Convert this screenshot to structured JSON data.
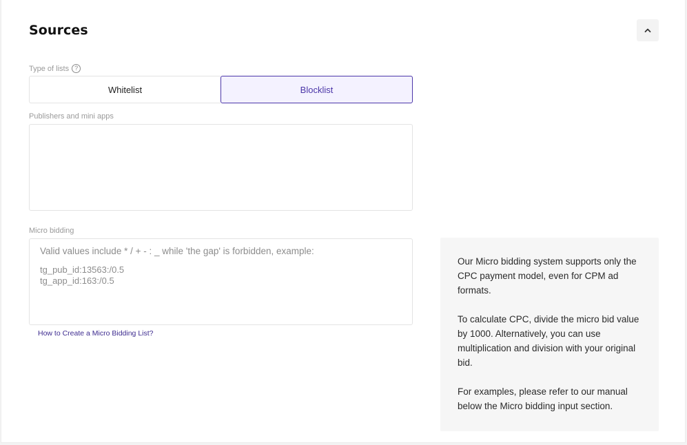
{
  "section": {
    "title": "Sources",
    "collapse_icon": "chevron-up-icon"
  },
  "type_of_lists": {
    "label": "Type of lists",
    "help_icon": "question-circle-icon",
    "options": [
      {
        "label": "Whitelist",
        "selected": false
      },
      {
        "label": "Blocklist",
        "selected": true
      }
    ]
  },
  "publishers": {
    "label": "Publishers and mini apps",
    "value": ""
  },
  "micro_bidding": {
    "label": "Micro bidding",
    "placeholder_lines": [
      "Valid values include * / + - : _ while 'the gap' is forbidden, example:",
      "",
      "tg_pub_id:13563:/0.5",
      "tg_app_id:163:/0.5"
    ],
    "help_link": "How to Create a Micro Bidding List?"
  },
  "info": {
    "paragraphs": [
      "Our Micro bidding system supports only the CPC payment model, even for CPM ad formats.",
      "To calculate CPC, divide the micro bid value by 1000. Alternatively, you can use multiplication and division with your original bid.",
      "For examples, please refer to our manual below the Micro bidding input section."
    ]
  },
  "colors": {
    "accent": "#4a35a8",
    "accent_bg": "#f4f2ff",
    "info_bg": "#f6f6f6"
  }
}
